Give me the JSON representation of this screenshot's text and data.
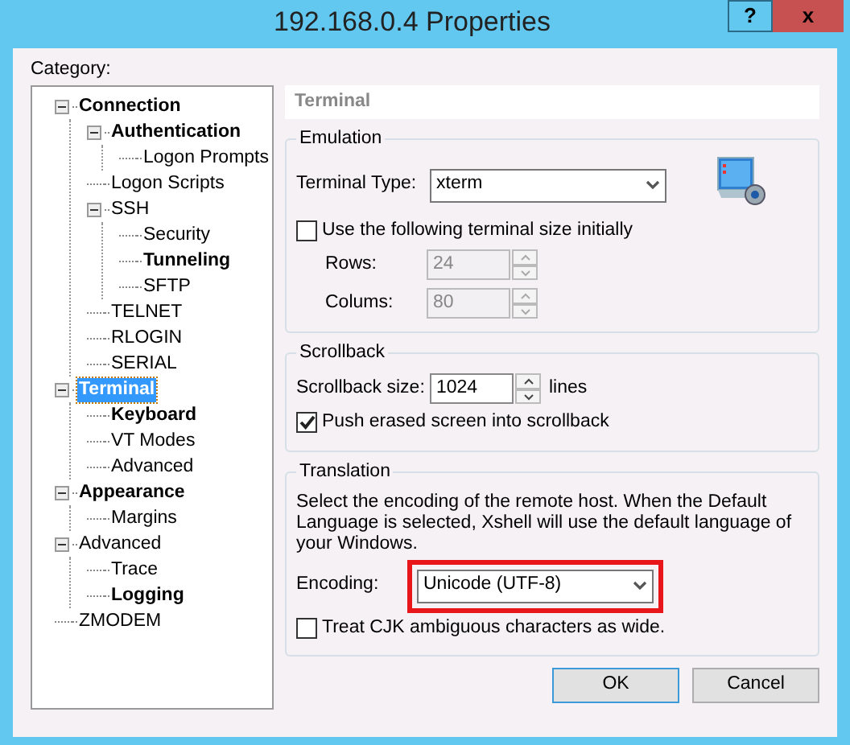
{
  "window": {
    "title": "192.168.0.4 Properties",
    "buttons": [
      {
        "kind": "help",
        "label": "?"
      },
      {
        "kind": "close",
        "label": "x"
      }
    ]
  },
  "category_label": "Category:",
  "tree": [
    {
      "label": "Connection",
      "bold": true,
      "selected": false,
      "expanded": true,
      "children": [
        {
          "label": "Authentication",
          "bold": true,
          "selected": false,
          "expanded": true,
          "children": [
            {
              "label": "Logon Prompts",
              "bold": false,
              "selected": false
            }
          ]
        },
        {
          "label": "Logon Scripts",
          "bold": false,
          "selected": false
        },
        {
          "label": "SSH",
          "bold": false,
          "selected": false,
          "expanded": true,
          "children": [
            {
              "label": "Security",
              "bold": false,
              "selected": false
            },
            {
              "label": "Tunneling",
              "bold": true,
              "selected": false
            },
            {
              "label": "SFTP",
              "bold": false,
              "selected": false
            }
          ]
        },
        {
          "label": "TELNET",
          "bold": false,
          "selected": false
        },
        {
          "label": "RLOGIN",
          "bold": false,
          "selected": false
        },
        {
          "label": "SERIAL",
          "bold": false,
          "selected": false
        }
      ]
    },
    {
      "label": "Terminal",
      "bold": true,
      "selected": true,
      "expanded": true,
      "children": [
        {
          "label": "Keyboard",
          "bold": true,
          "selected": false
        },
        {
          "label": "VT Modes",
          "bold": false,
          "selected": false
        },
        {
          "label": "Advanced",
          "bold": false,
          "selected": false
        }
      ]
    },
    {
      "label": "Appearance",
      "bold": true,
      "selected": false,
      "expanded": true,
      "children": [
        {
          "label": "Margins",
          "bold": false,
          "selected": false
        }
      ]
    },
    {
      "label": "Advanced",
      "bold": false,
      "selected": false,
      "expanded": true,
      "children": [
        {
          "label": "Trace",
          "bold": false,
          "selected": false
        },
        {
          "label": "Logging",
          "bold": true,
          "selected": false
        }
      ]
    },
    {
      "label": "ZMODEM",
      "bold": false,
      "selected": false
    }
  ],
  "page_title": "Terminal",
  "emulation": {
    "title": "Emulation",
    "terminal_type_label": "Terminal Type:",
    "terminal_type": "xterm",
    "use_size": {
      "label": "Use the following terminal size initially",
      "checked": false
    },
    "rows_label": "Rows:",
    "rows": "24",
    "columns_label": "Colums:",
    "columns": "80"
  },
  "scrollback": {
    "title": "Scrollback",
    "size_label": "Scrollback size:",
    "size": "1024",
    "unit": "lines",
    "push": {
      "label": "Push erased screen into scrollback",
      "checked": true
    }
  },
  "translation": {
    "title": "Translation",
    "description": "Select the encoding of the remote host. When the Default Language is selected, Xshell will use the default language of your Windows.",
    "encoding_label": "Encoding:",
    "encoding": "Unicode (UTF-8)",
    "highlighted": true,
    "cjk": {
      "label": "Treat CJK ambiguous characters as wide.",
      "checked": false
    }
  },
  "buttons": [
    "OK",
    "Cancel"
  ]
}
